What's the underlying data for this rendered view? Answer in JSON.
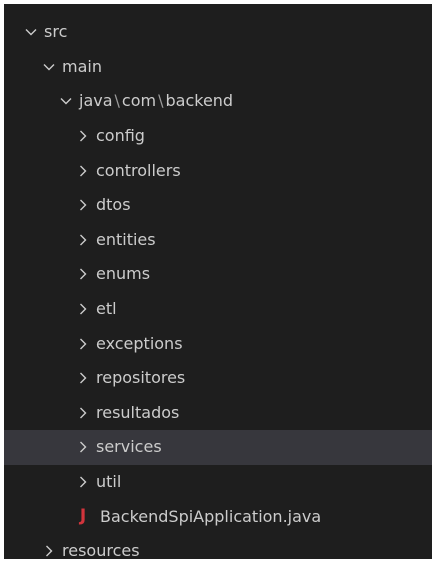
{
  "tree": {
    "src": {
      "label": "src",
      "expanded": true
    },
    "main": {
      "label": "main",
      "expanded": true
    },
    "package": {
      "segments": [
        "java",
        "com",
        "backend"
      ],
      "separator": "\\",
      "expanded": true
    },
    "folders": [
      {
        "label": "config",
        "expanded": false
      },
      {
        "label": "controllers",
        "expanded": false
      },
      {
        "label": "dtos",
        "expanded": false
      },
      {
        "label": "entities",
        "expanded": false
      },
      {
        "label": "enums",
        "expanded": false
      },
      {
        "label": "etl",
        "expanded": false
      },
      {
        "label": "exceptions",
        "expanded": false
      },
      {
        "label": "repositores",
        "expanded": false
      },
      {
        "label": "resultados",
        "expanded": false
      },
      {
        "label": "services",
        "expanded": false,
        "selected": true
      },
      {
        "label": "util",
        "expanded": false
      }
    ],
    "file": {
      "label": "BackendSpiApplication.java",
      "icon": "J",
      "icon_color": "#d2343c"
    },
    "resources": {
      "label": "resources",
      "expanded": false
    }
  },
  "colors": {
    "panel_bg": "#1e1e1e",
    "selected_bg": "#37373d",
    "text": "#cccccc",
    "separator": "#9a9a9a"
  }
}
